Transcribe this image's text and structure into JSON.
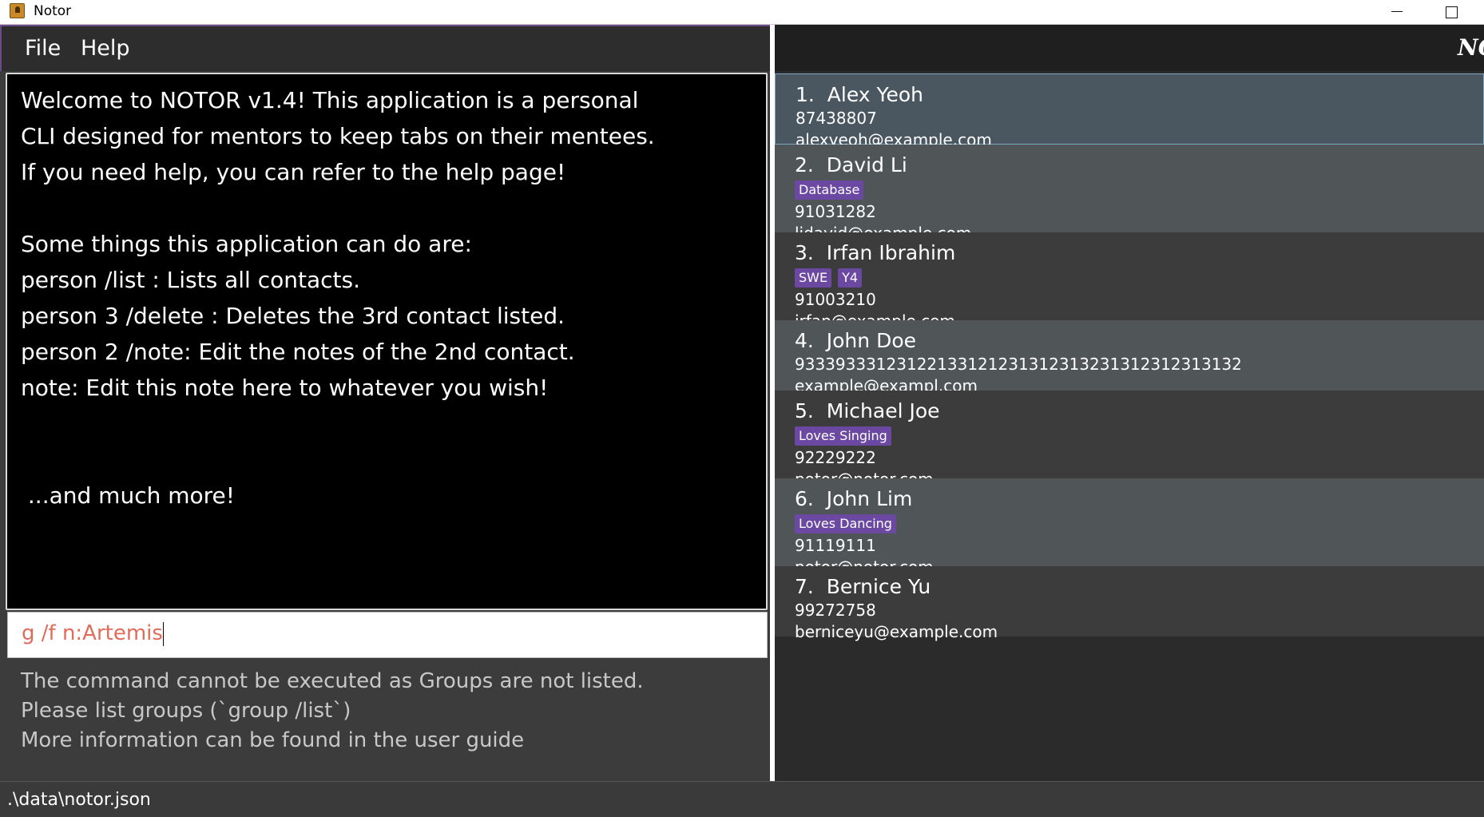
{
  "window": {
    "title": "Notor"
  },
  "menu": {
    "file": "File",
    "help": "Help"
  },
  "brand": "NOTOR",
  "result_display": {
    "lines": [
      "Welcome to NOTOR v1.4! This application is a personal",
      "CLI designed for mentors to keep tabs on their mentees.",
      "If you need help, you can refer to the help page!",
      "",
      "Some things this application can do are:",
      "person /list : Lists all contacts.",
      "person 3 /delete : Deletes the 3rd contact listed.",
      "person 2 /note: Edit the notes of the 2nd contact.",
      "note: Edit this note here to whatever you wish!",
      "",
      "",
      " ...and much more!"
    ]
  },
  "command": {
    "value": "g /f n:Artemis"
  },
  "feedback": {
    "lines": [
      "The command cannot be executed as Groups are not listed.",
      "Please list groups (`group /list`)",
      "More information can be found in the user guide"
    ]
  },
  "persons": [
    {
      "index": "1.",
      "name": "Alex Yeoh",
      "tags": [],
      "phone": "87438807",
      "email": "alexyeoh@example.com"
    },
    {
      "index": "2.",
      "name": "David Li",
      "tags": [
        "Database"
      ],
      "phone": "91031282",
      "email": "lidavid@example.com"
    },
    {
      "index": "3.",
      "name": "Irfan Ibrahim",
      "tags": [
        "SWE",
        "Y4"
      ],
      "phone": "91003210",
      "email": "irfan@example.com"
    },
    {
      "index": "4.",
      "name": "John Doe",
      "tags": [],
      "phone": "9333933312312213312123131231323131231231313​2",
      "email": "example@exampl.com"
    },
    {
      "index": "5.",
      "name": "Michael Joe",
      "tags": [
        "Loves Singing"
      ],
      "phone": "92229222",
      "email": "notor@notor.com"
    },
    {
      "index": "6.",
      "name": "John Lim",
      "tags": [
        "Loves Dancing"
      ],
      "phone": "91119111",
      "email": "notor@notor.com"
    },
    {
      "index": "7.",
      "name": "Bernice Yu",
      "tags": [],
      "phone": "99272758",
      "email": "berniceyu@example.com"
    }
  ],
  "status": {
    "path": ".\\data\\notor.json"
  },
  "colors": {
    "tag": "#6b49a3",
    "card_odd": "#505558",
    "card_even": "#3c3c3c",
    "selected_card": "#4a5761",
    "command_text": "#e26b5a"
  }
}
